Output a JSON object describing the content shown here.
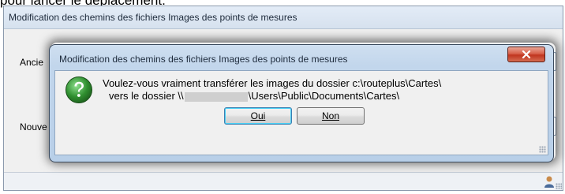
{
  "page_caption": "pour lancer le déplacement.",
  "background_window": {
    "title": "Modification des chemins des fichiers Images des points de mesures",
    "label_old": "Ancie",
    "label_new": "Nouve"
  },
  "dialog": {
    "title": "Modification des chemins des fichiers Images des points de mesures",
    "close_glyph": "x",
    "icon": "question-icon",
    "message_line1": "Voulez-vous vraiment transférer les images du dossier c:\\routeplus\\Cartes\\",
    "message_line2_prefix": "vers le dossier \\\\",
    "message_line2_suffix": "\\Users\\Public\\Documents\\Cartes\\",
    "buttons": {
      "yes": "Oui",
      "no": "Non"
    }
  },
  "colors": {
    "close_button": "#c0351f",
    "dialog_frame": "#b8cfe8",
    "icon_fill": "#2f8f2f"
  }
}
